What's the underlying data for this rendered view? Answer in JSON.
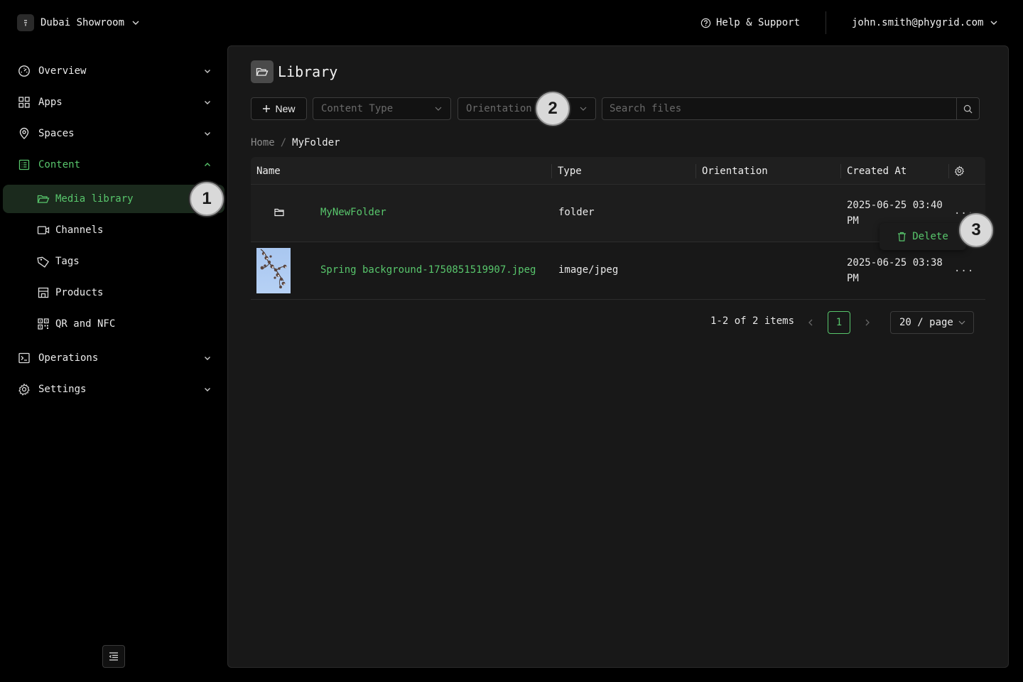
{
  "org": {
    "name": "Dubai Showroom"
  },
  "header": {
    "help_label": "Help & Support",
    "user_email": "john.smith@phygrid.com"
  },
  "sidebar": {
    "items": [
      {
        "label": "Overview",
        "icon": "gauge-icon"
      },
      {
        "label": "Apps",
        "icon": "grid-icon"
      },
      {
        "label": "Spaces",
        "icon": "map-pin-icon"
      },
      {
        "label": "Content",
        "icon": "content-icon"
      },
      {
        "label": "Operations",
        "icon": "terminal-icon"
      },
      {
        "label": "Settings",
        "icon": "gear-icon"
      }
    ],
    "sub_items": [
      {
        "label": "Media library",
        "icon": "folder-open-icon"
      },
      {
        "label": "Channels",
        "icon": "video-icon"
      },
      {
        "label": "Tags",
        "icon": "tag-icon"
      },
      {
        "label": "Products",
        "icon": "store-icon"
      },
      {
        "label": "QR and NFC",
        "icon": "qr-icon"
      }
    ]
  },
  "page": {
    "title": "Library"
  },
  "toolbar": {
    "new_label": "New",
    "content_type_placeholder": "Content Type",
    "orientation_placeholder": "Orientation",
    "search_placeholder": "Search files"
  },
  "breadcrumb": {
    "home": "Home",
    "separator": "/",
    "current": "MyFolder"
  },
  "table": {
    "columns": [
      "Name",
      "Type",
      "Orientation",
      "Created At"
    ],
    "rows": [
      {
        "name": "MyNewFolder",
        "type": "folder",
        "orientation": "",
        "created_at": "2025-06-25 03:40 PM",
        "more": "..."
      },
      {
        "name": "Spring background-1750851519907.jpeg",
        "type": "image/jpeg",
        "orientation": "",
        "created_at": "2025-06-25 03:38 PM",
        "more": "..."
      }
    ]
  },
  "row_menu": {
    "delete_label": "Delete"
  },
  "pagination": {
    "total_text": "1-2 of 2 items",
    "current_page": "1",
    "page_size": "20 / page"
  },
  "markers": [
    "1",
    "2",
    "3"
  ],
  "colors": {
    "accent": "#58c66c",
    "background": "#000000",
    "panel": "#181818",
    "active_nav_bg": "#1b2a1d"
  }
}
